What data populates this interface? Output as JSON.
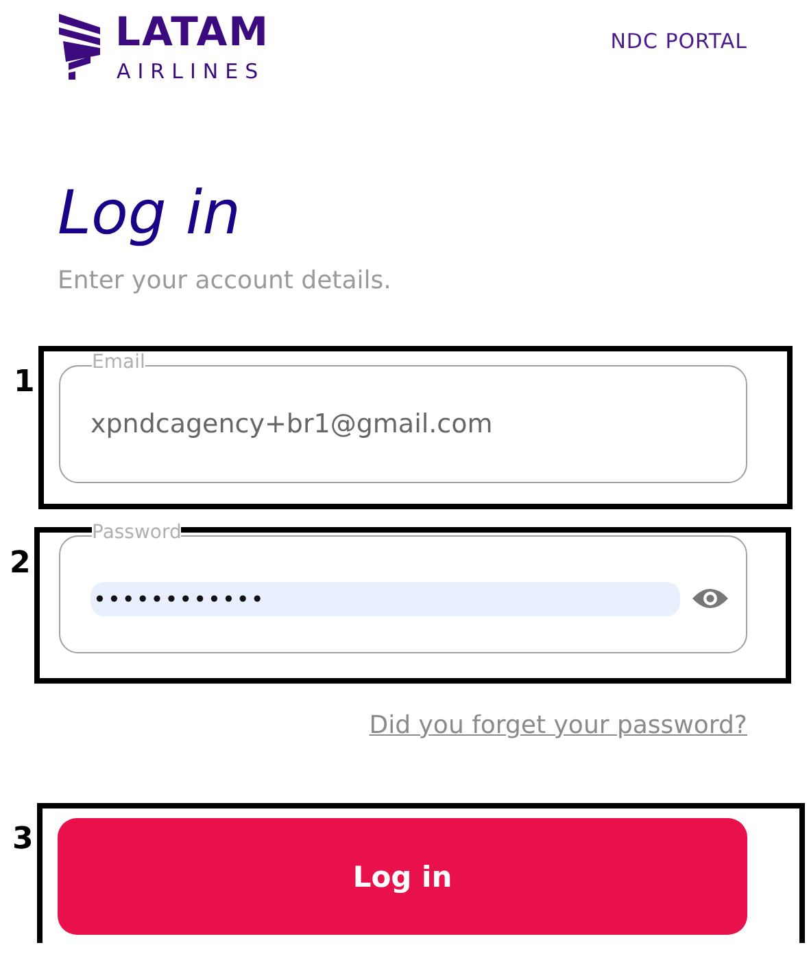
{
  "header": {
    "logo": {
      "name": "LATAM",
      "tagline": "AIRLINES"
    },
    "portal_label": "NDC PORTAL"
  },
  "heading": "Log in",
  "subtitle": "Enter your account details.",
  "fields": [
    {
      "kind": "email",
      "label": "Email",
      "value": "xpndcagency+br1@gmail.com",
      "marker": "1"
    },
    {
      "kind": "password",
      "label": "Password",
      "value": "••••••••••••",
      "marker": "2"
    }
  ],
  "forgot_link": "Did you forget your password?",
  "submit_button": {
    "label": "Log in",
    "marker": "3"
  }
}
